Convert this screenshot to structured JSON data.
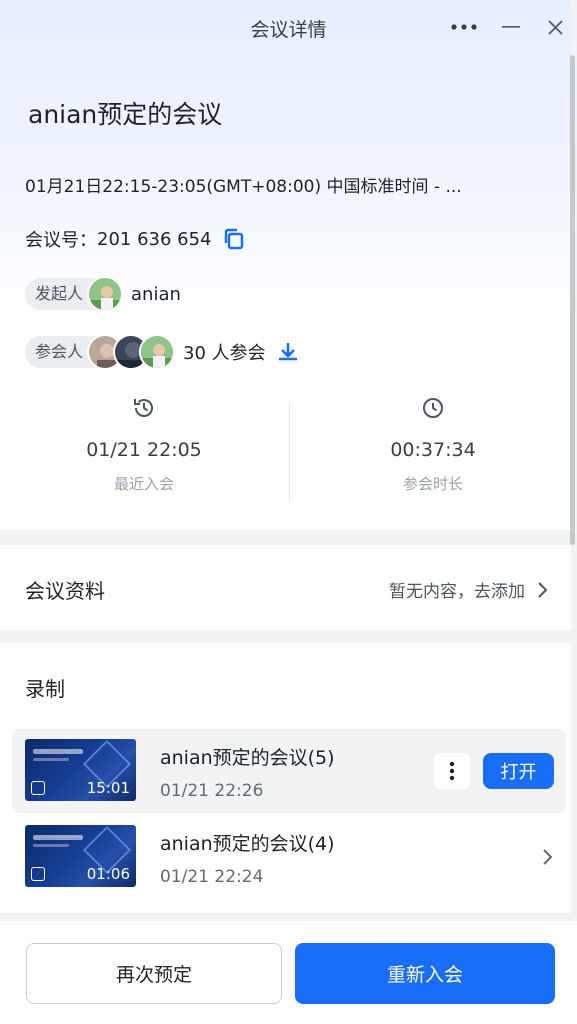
{
  "window": {
    "title": "会议详情"
  },
  "meeting": {
    "title": "anian预定的会议",
    "time": "01月21日22:15-23:05(GMT+08:00) 中国标准时间 - ...",
    "id_label": "会议号：",
    "id_value": "201 636 654",
    "host_label": "发起人",
    "host_name": "anian",
    "participants_label": "参会人",
    "participants_count": "30 人参会"
  },
  "stats": {
    "recent_join": {
      "value": "01/21 22:05",
      "label": "最近入会",
      "icon": "history-icon"
    },
    "duration": {
      "value": "00:37:34",
      "label": "参会时长",
      "icon": "clock-icon"
    }
  },
  "materials": {
    "title": "会议资料",
    "action": "暂无内容，去添加"
  },
  "recording": {
    "title": "录制",
    "items": [
      {
        "name": "anian预定的会议(5)",
        "date": "01/21 22:26",
        "duration": "15:01",
        "open_label": "打开"
      },
      {
        "name": "anian预定的会议(4)",
        "date": "01/21 22:24",
        "duration": "01:06"
      }
    ]
  },
  "footer": {
    "reschedule": "再次预定",
    "rejoin": "重新入会"
  },
  "colors": {
    "accent": "#1a6ef5",
    "text": "#1f2329",
    "muted": "#9aa0a9"
  }
}
